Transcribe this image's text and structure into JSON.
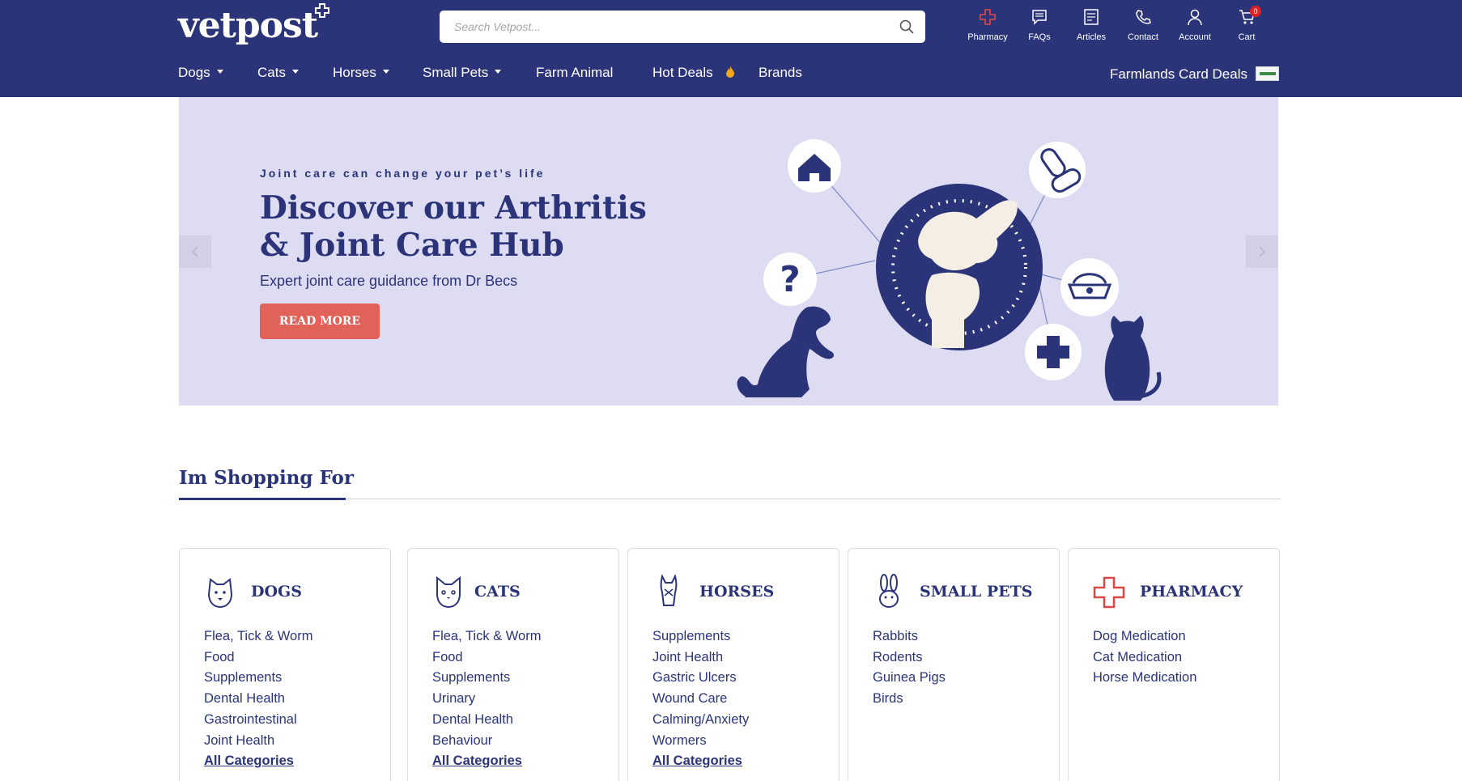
{
  "header": {
    "logo_text": "vetpost",
    "search": {
      "placeholder": "Search Vetpost..."
    },
    "icons": [
      {
        "label": "Pharmacy",
        "icon": "pharmacy-cross-icon"
      },
      {
        "label": "FAQs",
        "icon": "chat-icon"
      },
      {
        "label": "Articles",
        "icon": "articles-icon"
      },
      {
        "label": "Contact",
        "icon": "phone-icon"
      },
      {
        "label": "Account",
        "icon": "user-icon"
      },
      {
        "label": "Cart",
        "icon": "cart-icon",
        "badge": "0"
      }
    ]
  },
  "nav": {
    "items": [
      "Dogs",
      "Cats",
      "Horses",
      "Small Pets",
      "Farm Animal",
      "Hot Deals",
      "Brands"
    ],
    "farmlands": "Farmlands Card Deals"
  },
  "hero": {
    "kicker": "Joint care can change your pet’s life",
    "title": "Discover our Arthritis & Joint Care Hub",
    "subtitle": "Expert joint care guidance from Dr Becs",
    "button": "READ MORE"
  },
  "shopping": {
    "title": "Im Shopping For",
    "categories": [
      {
        "title": "DOGS",
        "icon": "dog-icon",
        "items": [
          "Flea, Tick & Worm",
          "Food",
          "Supplements",
          "Dental Health",
          "Gastrointestinal",
          "Joint Health"
        ],
        "all": "All Categories"
      },
      {
        "title": "CATS",
        "icon": "cat-icon",
        "items": [
          "Flea, Tick & Worm",
          "Food",
          "Supplements",
          "Urinary",
          "Dental Health",
          "Behaviour"
        ],
        "all": "All Categories"
      },
      {
        "title": "HORSES",
        "icon": "horse-icon",
        "items": [
          "Supplements",
          "Joint Health",
          "Gastric Ulcers",
          "Wound Care",
          "Calming/Anxiety",
          "Wormers"
        ],
        "all": "All Categories"
      },
      {
        "title": "SMALL PETS",
        "icon": "rabbit-icon",
        "items": [
          "Rabbits",
          "Rodents",
          "Guinea Pigs",
          "Birds"
        ]
      },
      {
        "title": "PHARMACY",
        "icon": "pharmacy-cross-icon",
        "items": [
          "Dog Medication",
          "Cat Medication",
          "Horse Medication"
        ]
      }
    ]
  },
  "colors": {
    "brand_navy": "#2b3478",
    "hero_bg": "#dedcf2",
    "cta_red": "#e06259",
    "pharmacy_red": "#e04848"
  }
}
